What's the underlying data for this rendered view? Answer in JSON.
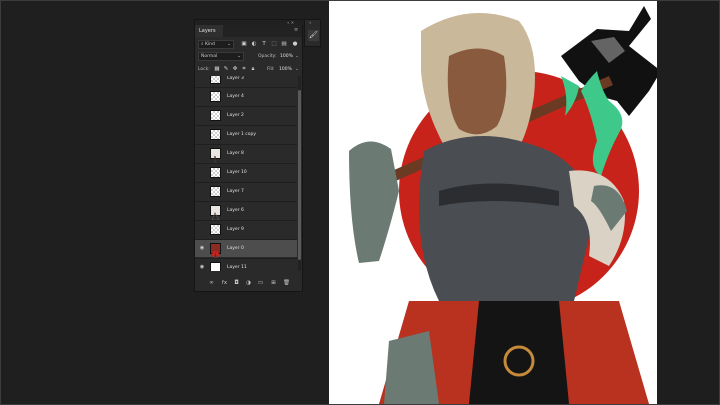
{
  "panel": {
    "tab": "Layers",
    "grip_controls": "«  ✕",
    "menu_glyph": "≡",
    "filter": {
      "kind_label": "Kind",
      "kind_icon": "search-icon"
    },
    "blend_mode": "Normal",
    "opacity_label": "Opacity:",
    "opacity_value": "100%",
    "lock_label": "Lock:",
    "fill_label": "Fill:",
    "fill_value": "100%",
    "layers": [
      {
        "name": "Layer 3",
        "visible": false,
        "thumb": "trans",
        "active": false
      },
      {
        "name": "Layer 4",
        "visible": false,
        "thumb": "trans",
        "active": false
      },
      {
        "name": "Layer 2",
        "visible": false,
        "thumb": "trans",
        "active": false
      },
      {
        "name": "Layer 1 copy",
        "visible": false,
        "thumb": "trans",
        "active": false
      },
      {
        "name": "Layer 8",
        "visible": false,
        "thumb": "art",
        "active": false
      },
      {
        "name": "Layer 10",
        "visible": false,
        "thumb": "trans",
        "active": false
      },
      {
        "name": "Layer 7",
        "visible": false,
        "thumb": "trans",
        "active": false
      },
      {
        "name": "Layer 6",
        "visible": false,
        "thumb": "art",
        "active": false
      },
      {
        "name": "Layer 9",
        "visible": false,
        "thumb": "trans",
        "active": false
      },
      {
        "name": "Layer 0",
        "visible": true,
        "thumb": "art2",
        "active": true
      },
      {
        "name": "Layer 11",
        "visible": true,
        "thumb": "white",
        "active": false
      }
    ]
  },
  "colors": {
    "red_circle": "#c8231b",
    "armor": "#4a4d52",
    "skirt": "#b8321f",
    "green_flame": "#3ec98a",
    "skin": "#8a5a3e",
    "hair": "#c9b89a"
  }
}
